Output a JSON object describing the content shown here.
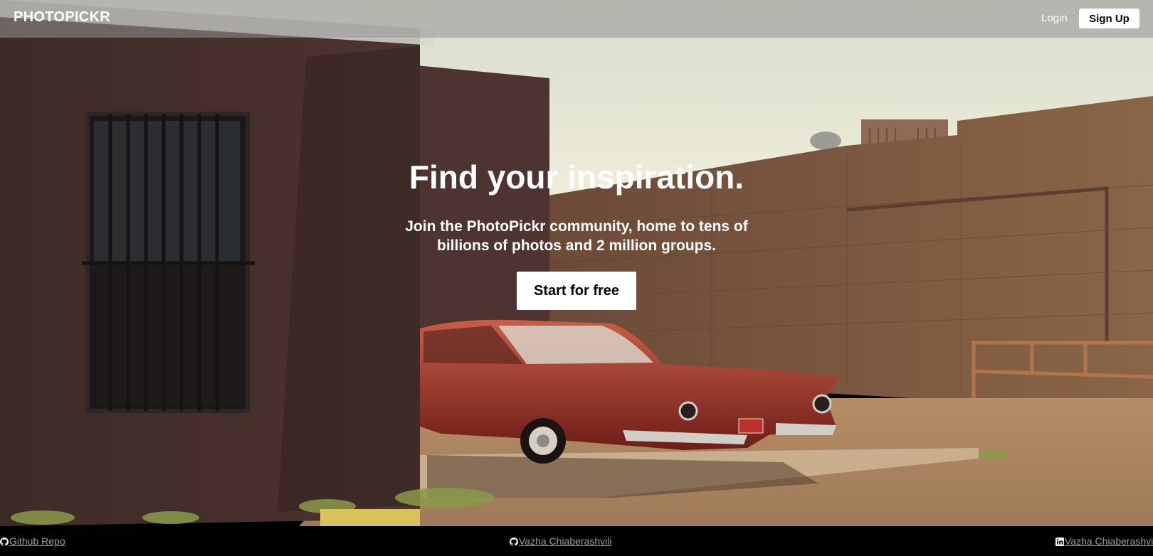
{
  "nav": {
    "brand": "PHOTOPICKR",
    "login_label": "Login",
    "signup_label": "Sign Up"
  },
  "hero": {
    "title": "Find your inspiration.",
    "subtitle": "Join the PhotoPickr community, home to tens of billions of photos and 2 million groups.",
    "cta_label": "Start for free"
  },
  "footer": {
    "links": [
      {
        "label": "Github Repo",
        "icon": "github-icon"
      },
      {
        "label": "Vazha Chiaberashvili",
        "icon": "github-icon"
      },
      {
        "label": "Vazha Chiaberashvili",
        "icon": "linkedin-icon"
      }
    ]
  },
  "colors": {
    "navbar_overlay": "#969696",
    "footer_bg": "#000000",
    "button_bg": "#ffffff",
    "footer_link": "#9a9a9a"
  }
}
